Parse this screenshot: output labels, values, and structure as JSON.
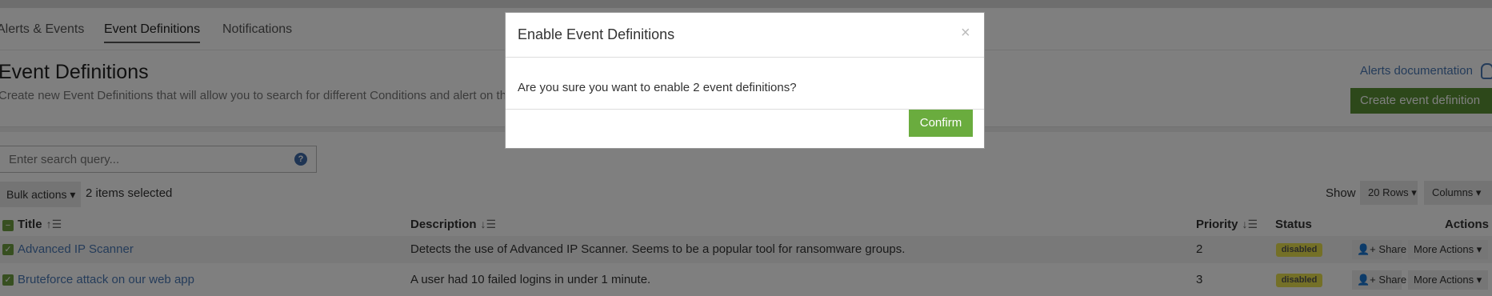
{
  "nav": {
    "tabs": [
      {
        "label": "Alerts & Events"
      },
      {
        "label": "Event Definitions"
      },
      {
        "label": "Notifications"
      }
    ]
  },
  "header": {
    "title": "Event Definitions",
    "description": "Create new Event Definitions that will allow you to search for different Conditions and alert on them.",
    "docs_link": "Alerts documentation",
    "create_button": "Create event definition"
  },
  "search": {
    "placeholder": "Enter search query...",
    "help_icon": "?"
  },
  "toolbar": {
    "bulk_actions": "Bulk actions",
    "selected_count": "2 items selected",
    "show_label": "Show",
    "rows_button": "20 Rows",
    "columns_button": "Columns"
  },
  "table": {
    "headers": {
      "title": "Title",
      "description": "Description",
      "priority": "Priority",
      "status": "Status",
      "actions": "Actions"
    },
    "rows": [
      {
        "title": "Advanced IP Scanner",
        "description": "Detects the use of Advanced IP Scanner. Seems to be a popular tool for ransomware groups.",
        "priority": "2",
        "status": "disabled",
        "share": "Share",
        "more": "More Actions"
      },
      {
        "title": "Bruteforce attack on our web app",
        "description": "A user had 10 failed logins in under 1 minute.",
        "priority": "3",
        "status": "disabled",
        "share": "Share",
        "more": "More Actions"
      }
    ]
  },
  "modal": {
    "title": "Enable Event Definitions",
    "close": "×",
    "message": "Are you sure you want to enable 2 event definitions?",
    "confirm": "Confirm"
  },
  "colors": {
    "primary": "#6aac3e",
    "link": "#4a79b5",
    "badge": "#e9e04e"
  },
  "icons": [
    "bulb-icon",
    "help-icon",
    "sort-asc-icon",
    "sort-desc-icon",
    "checkbox-icon",
    "share-icon",
    "caret-down-icon",
    "close-icon"
  ]
}
